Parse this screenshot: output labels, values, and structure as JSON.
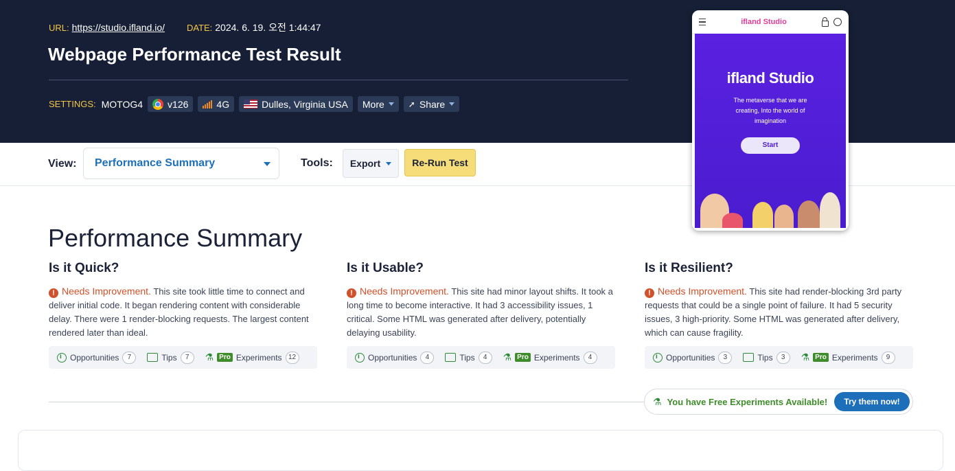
{
  "header": {
    "url_key": "URL:",
    "url": "https://studio.ifland.io/",
    "date_key": "DATE:",
    "date": "2024. 6. 19. 오전 1:44:47",
    "title": "Webpage Performance Test Result",
    "settings_key": "SETTINGS:",
    "device": "MOTOG4",
    "browser_version": "v126",
    "network": "4G",
    "location": "Dulles, Virginia USA",
    "more_label": "More",
    "share_label": "Share"
  },
  "toolbar": {
    "view_label": "View:",
    "view_selected": "Performance Summary",
    "tools_label": "Tools:",
    "export_label": "Export",
    "rerun_label": "Re-Run Test"
  },
  "screenshot": {
    "logo": "ifland Studio",
    "brand": "ifland Studio",
    "tagline": "The metaverse that we are creating, Into the world of imagination",
    "start_label": "Start"
  },
  "summary": {
    "title": "Performance Summary",
    "columns": [
      {
        "heading": "Is it Quick?",
        "status": "Needs Improvement.",
        "text": "This site took little time to connect and deliver initial code. It began rendering content with considerable delay. There were 1 render-blocking requests. The largest content rendered later than ideal.",
        "opportunities_label": "Opportunities",
        "opportunities": "7",
        "tips_label": "Tips",
        "tips": "7",
        "pro_label": "Pro",
        "experiments_label": "Experiments",
        "experiments": "12"
      },
      {
        "heading": "Is it Usable?",
        "status": "Needs Improvement.",
        "text": "This site had minor layout shifts. It took a long time to become interactive. It had 3 accessibility issues, 1 critical. Some HTML was generated after delivery, potentially delaying usability.",
        "opportunities_label": "Opportunities",
        "opportunities": "4",
        "tips_label": "Tips",
        "tips": "4",
        "pro_label": "Pro",
        "experiments_label": "Experiments",
        "experiments": "4"
      },
      {
        "heading": "Is it Resilient?",
        "status": "Needs Improvement.",
        "text": "This site had render-blocking 3rd party requests that could be a single point of failure. It had 5 security issues, 3 high-priority. Some HTML was generated after delivery, which can cause fragility.",
        "opportunities_label": "Opportunities",
        "opportunities": "3",
        "tips_label": "Tips",
        "tips": "3",
        "pro_label": "Pro",
        "experiments_label": "Experiments",
        "experiments": "9"
      }
    ]
  },
  "free_experiments": {
    "text": "You have Free Experiments Available!",
    "button": "Try them now!"
  },
  "colors": {
    "header_bg": "#161f35",
    "accent_blue": "#1c6fb8",
    "warning": "#d2502a",
    "rerun_bg": "#f6dd7a",
    "pro_green": "#3f8c2a"
  }
}
